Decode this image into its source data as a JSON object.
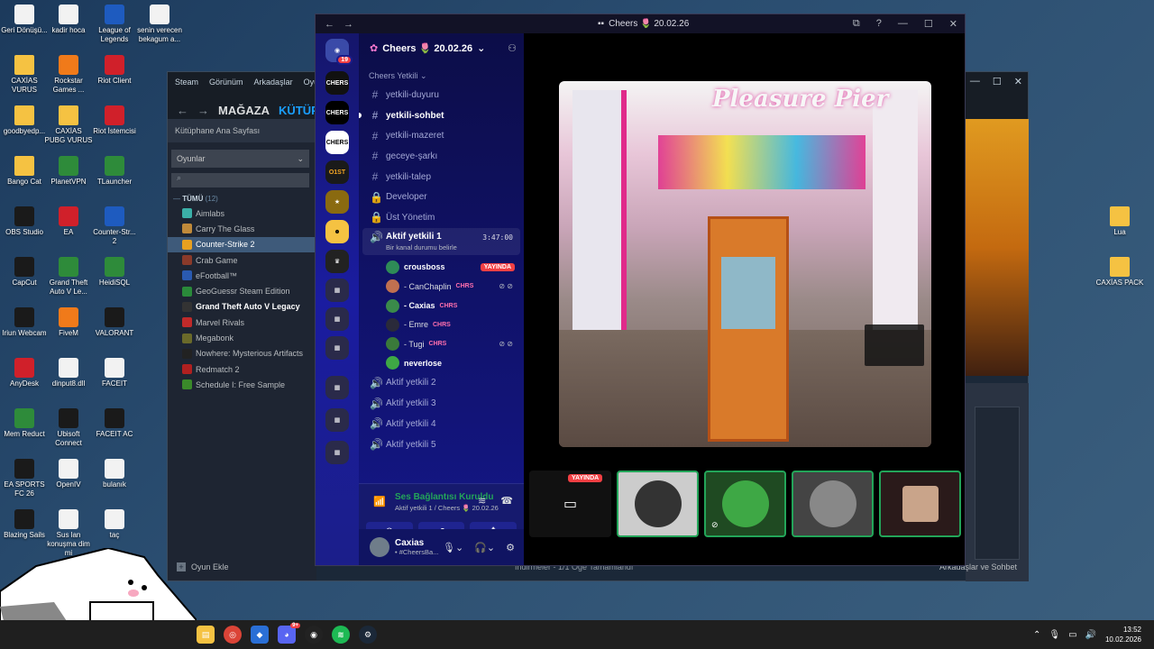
{
  "desktop": {
    "icons": [
      {
        "label": "Geri Dönüşü...",
        "icon": "recycle-bin-icon"
      },
      {
        "label": "kadir hoca",
        "icon": "video-file-icon"
      },
      {
        "label": "League of Legends",
        "icon": "league-icon"
      },
      {
        "label": "senin verecen bekagum a...",
        "icon": "document-icon"
      },
      {
        "label": "CAXİAS VURUS",
        "icon": "folder-icon"
      },
      {
        "label": "Rockstar Games ...",
        "icon": "rockstar-icon"
      },
      {
        "label": "Riot Client",
        "icon": "riot-icon"
      },
      {
        "label": "goodbyedp...",
        "icon": "folder-icon"
      },
      {
        "label": "CAXİAS PUBG VURUS",
        "icon": "folder-icon"
      },
      {
        "label": "Riot İstemcisi",
        "icon": "riot-icon"
      },
      {
        "label": "Bango Cat",
        "icon": "folder-icon"
      },
      {
        "label": "PlanetVPN",
        "icon": "vpn-icon"
      },
      {
        "label": "TLauncher",
        "icon": "tlauncher-icon"
      },
      {
        "label": "OBS Studio",
        "icon": "obs-icon"
      },
      {
        "label": "EA",
        "icon": "ea-icon"
      },
      {
        "label": "Counter-Str... 2",
        "icon": "cs2-icon"
      },
      {
        "label": "CapCut",
        "icon": "capcut-icon"
      },
      {
        "label": "Grand Theft Auto V Le...",
        "icon": "gta-icon"
      },
      {
        "label": "HeidiSQL",
        "icon": "heidisql-icon"
      },
      {
        "label": "Iriun Webcam",
        "icon": "webcam-icon"
      },
      {
        "label": "FiveM",
        "icon": "fivem-icon"
      },
      {
        "label": "VALORANT",
        "icon": "valorant-icon"
      },
      {
        "label": "AnyDesk",
        "icon": "anydesk-icon"
      },
      {
        "label": "dinput8.dll",
        "icon": "dll-file-icon"
      },
      {
        "label": "FACEIT",
        "icon": "document-icon"
      },
      {
        "label": "Mem Reduct",
        "icon": "memreduct-icon"
      },
      {
        "label": "Ubisoft Connect",
        "icon": "ubisoft-icon"
      },
      {
        "label": "FACEIT AC",
        "icon": "faceit-ac-icon"
      },
      {
        "label": "EA SPORTS FC 26",
        "icon": "fc26-icon"
      },
      {
        "label": "OpenIV",
        "icon": "openiv-icon"
      },
      {
        "label": "bulanık",
        "icon": "document-icon"
      },
      {
        "label": "Blazing Sails",
        "icon": "epic-icon"
      },
      {
        "label": "Sus lan konuşma dim mi",
        "icon": "video-file-icon"
      },
      {
        "label": "taç",
        "icon": "document-icon"
      },
      {
        "label": "Lua",
        "icon": "folder-icon"
      },
      {
        "label": "CAXİAS PACK",
        "icon": "folder-icon"
      }
    ]
  },
  "steam": {
    "menu": [
      "Steam",
      "Görünüm",
      "Arkadaşlar",
      "Oyu"
    ],
    "tabs": {
      "store": "MAĞAZA",
      "library": "KÜTÜPH"
    },
    "home": "Kütüphane Ana Sayfası",
    "filter": "Oyunlar",
    "all_label": "TÜMÜ",
    "all_count": "(12)",
    "games": [
      {
        "name": "Aimlabs",
        "state": "normal"
      },
      {
        "name": "Carry The Glass",
        "state": "normal"
      },
      {
        "name": "Counter-Strike 2",
        "state": "selected"
      },
      {
        "name": "Crab Game",
        "state": "normal"
      },
      {
        "name": "eFootball™",
        "state": "normal"
      },
      {
        "name": "GeoGuessr Steam Edition",
        "state": "normal"
      },
      {
        "name": "Grand Theft Auto V Legacy",
        "state": "bold"
      },
      {
        "name": "Marvel Rivals",
        "state": "normal"
      },
      {
        "name": "Megabonk",
        "state": "normal"
      },
      {
        "name": "Nowhere: Mysterious Artifacts",
        "state": "normal"
      },
      {
        "name": "Redmatch 2",
        "state": "normal"
      },
      {
        "name": "Schedule I: Free Sample",
        "state": "normal"
      }
    ],
    "add_game": "Oyun Ekle",
    "downloads": "İndirmeler - 1/1 Öğe Tamamlandı",
    "friends": "Arkadaşlar ve Sohbet"
  },
  "discord": {
    "window_title": "Cheers 🌷 20.02.26",
    "server_name": "Cheers 🌷 20.02.26",
    "server_badge": "19",
    "server_labels": [
      "CHERS",
      "CHERS",
      "CHERS",
      "O1ST"
    ],
    "category": "Cheers Yetkili",
    "text_channels": [
      {
        "name": "yetkili-duyuru",
        "kind": "text",
        "bright": false
      },
      {
        "name": "yetkili-sohbet",
        "kind": "text",
        "bright": true
      },
      {
        "name": "yetkili-mazeret",
        "kind": "text",
        "bright": false
      },
      {
        "name": "geceye-şarkı",
        "kind": "text",
        "bright": false
      },
      {
        "name": "yetkili-talep",
        "kind": "text",
        "bright": false
      },
      {
        "name": "Developer",
        "kind": "locked",
        "bright": false
      },
      {
        "name": "Üst Yönetim",
        "kind": "locked",
        "bright": false
      }
    ],
    "active_voice": {
      "name": "Aktif yetkili 1",
      "timer": "3:47:00",
      "status": "Bir kanal durumu belirle"
    },
    "voice_users": [
      {
        "name": "crousboss",
        "tag": "",
        "live": "YAYINDA",
        "muted": false,
        "bold": true
      },
      {
        "name": "- CanChaplin",
        "tag": "CHRS",
        "live": "",
        "muted": true,
        "bold": false
      },
      {
        "name": "- Caxias",
        "tag": "CHRS",
        "live": "",
        "muted": false,
        "bold": true
      },
      {
        "name": "- Emre",
        "tag": "CHRS",
        "live": "",
        "muted": false,
        "bold": false
      },
      {
        "name": "- Tugi",
        "tag": "CHRS",
        "live": "",
        "muted": true,
        "bold": false
      },
      {
        "name": "neverlose",
        "tag": "",
        "live": "",
        "muted": false,
        "bold": true
      }
    ],
    "other_voice": [
      "Aktif yetkili 2",
      "Aktif yetkili 3",
      "Aktif yetkili 4",
      "Aktif yetkili 5"
    ],
    "voice_panel": {
      "status": "Ses Bağlantısı Kuruldu",
      "channel": "Aktif yetkili 1 / Cheers 🌷 20.02.26"
    },
    "user": {
      "name": "Caxias",
      "status": "• #CheersBa..."
    },
    "stream": {
      "sign": "Pleasure Pier",
      "live_label": "YAYINDA"
    }
  },
  "taskbar": {
    "time": "13:52",
    "date": "10.02.2026",
    "discord_badge": "9+"
  },
  "colors": {
    "discord_green": "#23a559",
    "live_red": "#f23f43",
    "steam_blue": "#1a9fff"
  }
}
